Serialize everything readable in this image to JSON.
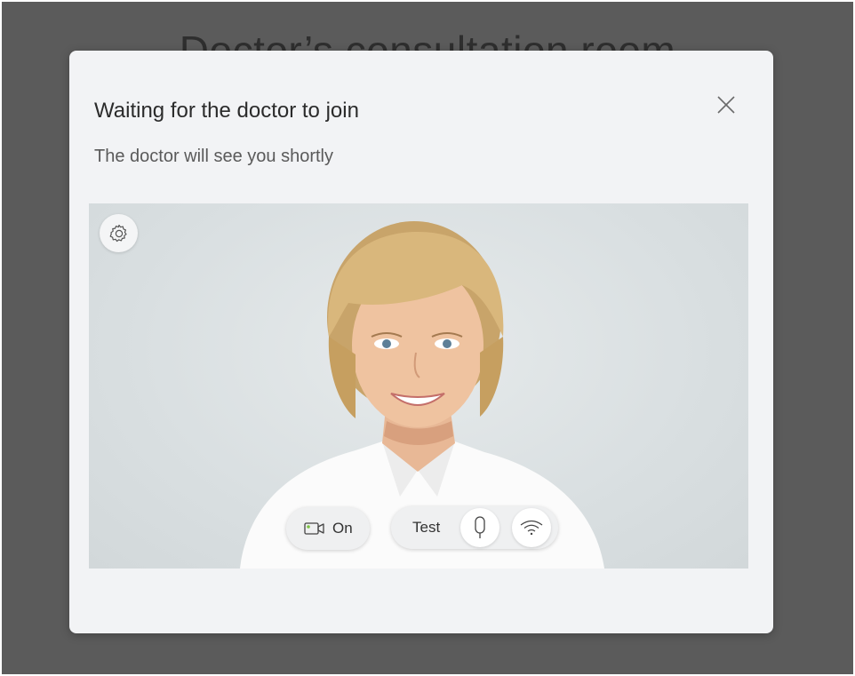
{
  "background": {
    "title": "Doctor’s consultation room"
  },
  "modal": {
    "title": "Waiting for the doctor to join",
    "subtitle": "The doctor will see you shortly",
    "close_icon": "close-icon"
  },
  "video": {
    "settings_icon": "gear-icon",
    "camera": {
      "icon": "video-camera-icon",
      "label": "On"
    },
    "test": {
      "label": "Test",
      "mic_icon": "microphone-icon",
      "network_icon": "wifi-icon"
    }
  },
  "colors": {
    "backdrop": "#5b5b5b",
    "modal_bg": "#f2f3f5",
    "camera_indicator": "#7cc242"
  }
}
